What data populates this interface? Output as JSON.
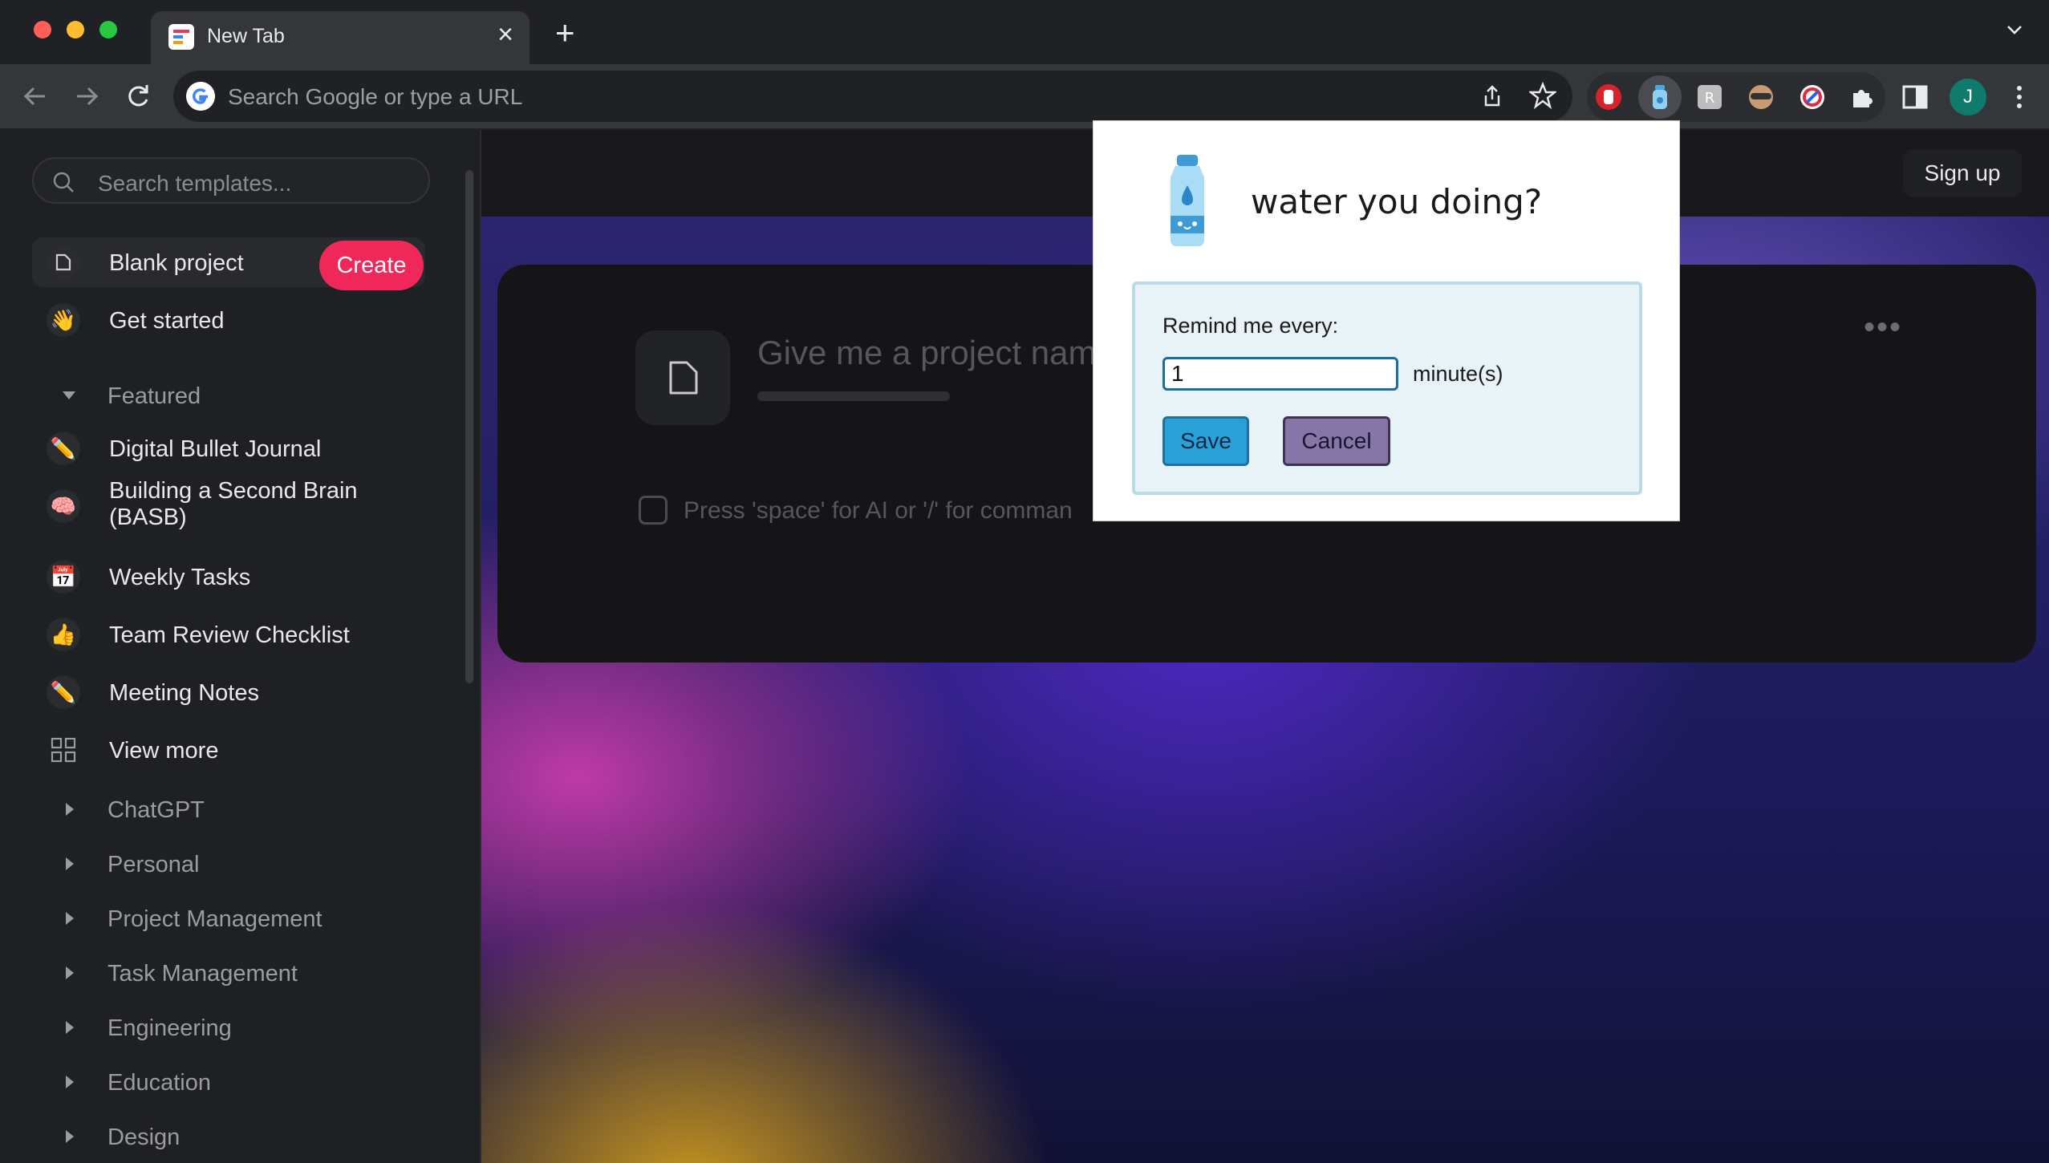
{
  "browser": {
    "tab_title": "New Tab",
    "tab_close": "×",
    "new_tab": "+",
    "omnibox_placeholder": "Search Google or type a URL",
    "profile_initial": "J"
  },
  "sidebar": {
    "search_placeholder": "Search templates...",
    "items": [
      {
        "label": "Blank project",
        "icon": "doc-icon"
      },
      {
        "label": "Get started",
        "icon": "wave-icon"
      }
    ],
    "create_label": "Create",
    "featured_label": "Featured",
    "featured_items": [
      {
        "label": "Digital Bullet Journal",
        "icon": "pencil-icon"
      },
      {
        "label": "Building a Second Brain\n(BASB)",
        "icon": "brain-icon"
      },
      {
        "label": "Weekly Tasks",
        "icon": "calendar-icon"
      },
      {
        "label": "Team Review Checklist",
        "icon": "thumbs-up-icon"
      },
      {
        "label": "Meeting Notes",
        "icon": "pencil-icon"
      },
      {
        "label": "View more",
        "icon": "grid-icon"
      }
    ],
    "sections": [
      "ChatGPT",
      "Personal",
      "Project Management",
      "Task Management",
      "Engineering",
      "Education",
      "Design"
    ]
  },
  "main": {
    "signup_label": "Sign up",
    "project_placeholder": "Give me a project nam",
    "command_hint": "Press 'space' for AI or '/' for comman",
    "more": "•••"
  },
  "popup": {
    "title": "water you doing?",
    "remind_label": "Remind me every:",
    "interval_value": "1",
    "unit_label": "minute(s)",
    "save_label": "Save",
    "cancel_label": "Cancel"
  },
  "colors": {
    "accent_create": "#f0285a",
    "save_button": "#2b9fd8",
    "cancel_button": "#8676a8"
  }
}
